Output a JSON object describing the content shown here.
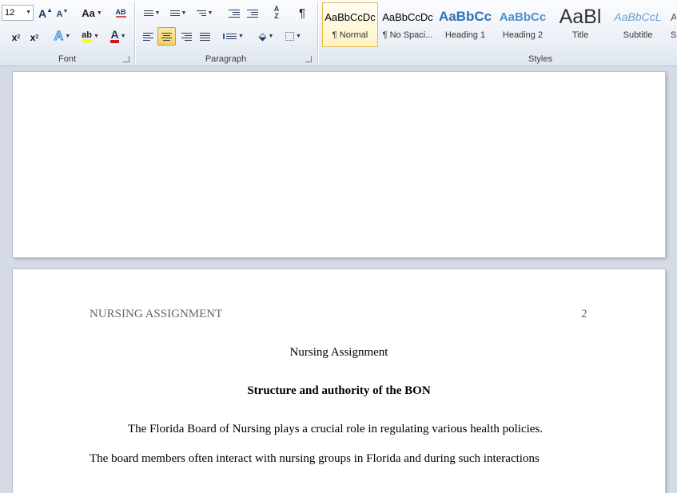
{
  "ribbon": {
    "font": {
      "label": "Font",
      "size_value": "12",
      "change_case_label": "Aa",
      "subscript_label": "x",
      "subscript_mark": "2",
      "superscript_label": "x",
      "superscript_mark": "2",
      "grow_label": "A",
      "shrink_label": "A",
      "text_effects_label": "A",
      "highlight_label": "ab",
      "font_color_label": "A",
      "clear_label": "AB"
    },
    "paragraph": {
      "label": "Paragraph",
      "pilcrow": "¶",
      "sort_label": "A",
      "sort_label2": "Z"
    },
    "styles": {
      "label": "Styles",
      "items": [
        {
          "sample": "AaBbCcDc",
          "name": "¶ Normal"
        },
        {
          "sample": "AaBbCcDc",
          "name": "¶ No Spaci..."
        },
        {
          "sample": "AaBbCc",
          "name": "Heading 1"
        },
        {
          "sample": "AaBbCc",
          "name": "Heading 2"
        },
        {
          "sample": "AaBl",
          "name": "Title"
        },
        {
          "sample": "AaBbCcL",
          "name": "Subtitle"
        },
        {
          "sample": "A",
          "name": "S"
        }
      ]
    }
  },
  "document": {
    "header_title": "NURSING ASSIGNMENT",
    "page_number": "2",
    "title": "Nursing Assignment",
    "heading": "Structure and authority of the BON",
    "paragraph_line1": "The Florida Board of Nursing plays a crucial role in regulating various health policies.",
    "paragraph_line2": "The board members often interact with nursing groups in Florida and during such interactions"
  },
  "colors": {
    "accent_blue": "#1e3a66",
    "heading_blue": "#2e74b5",
    "font_color_red": "#d0181e",
    "highlight_yellow": "#ffff00",
    "header_gray": "#666666"
  }
}
